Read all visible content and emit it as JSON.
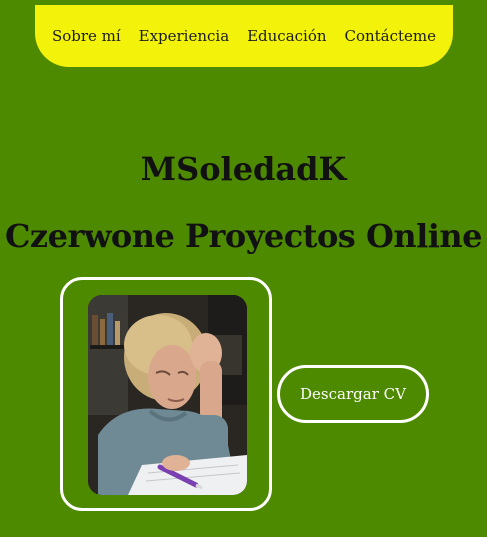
{
  "nav": {
    "items": [
      {
        "label": "Sobre mí"
      },
      {
        "label": "Experiencia"
      },
      {
        "label": "Educación"
      },
      {
        "label": "Contácteme"
      }
    ]
  },
  "hero": {
    "name": "MSoledadK",
    "subtitle": "Czerwone Proyectos Online",
    "photo_icon": "portrait-photo",
    "download_label": "Descargar CV"
  },
  "colors": {
    "background": "#4e8a00",
    "nav_background": "#f2f20a",
    "border": "#ffffff",
    "title_text": "#111111"
  }
}
